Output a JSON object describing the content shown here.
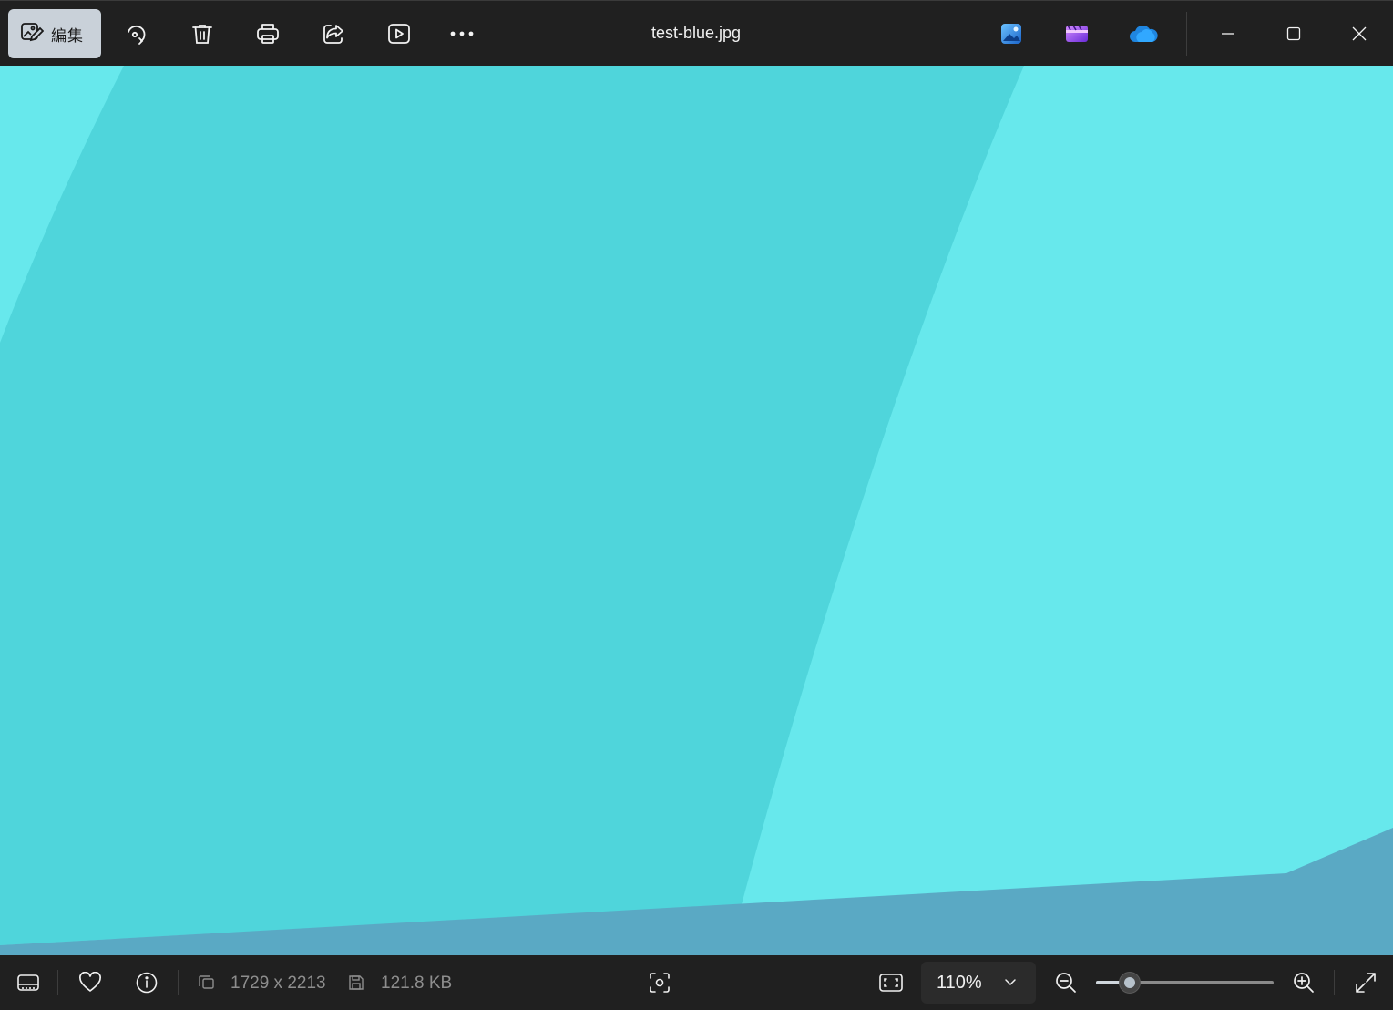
{
  "window": {
    "title": "test-blue.jpg"
  },
  "toolbar": {
    "edit_label": "編集",
    "buttons": [
      {
        "name": "rotate",
        "icon": "rotate-icon"
      },
      {
        "name": "delete",
        "icon": "trash-icon"
      },
      {
        "name": "print",
        "icon": "print-icon"
      },
      {
        "name": "share",
        "icon": "share-icon"
      },
      {
        "name": "slideshow",
        "icon": "play-icon"
      },
      {
        "name": "more",
        "icon": "more-icon"
      }
    ],
    "apps": [
      "photo-editor-icon",
      "clipchamp-icon",
      "onedrive-icon"
    ]
  },
  "image": {
    "colors": {
      "light_cyan": "#67e8ec",
      "mid_cyan": "#4fd5db",
      "steel_blue": "#5aa9c4"
    }
  },
  "statusbar": {
    "dimensions": "1729 x 2213",
    "file_size": "121.8 KB",
    "zoom": "110%",
    "zoom_level": 0.19
  },
  "colors": {
    "titlebar_bg": "#202020",
    "edit_button_bg": "#c9d1d9"
  }
}
